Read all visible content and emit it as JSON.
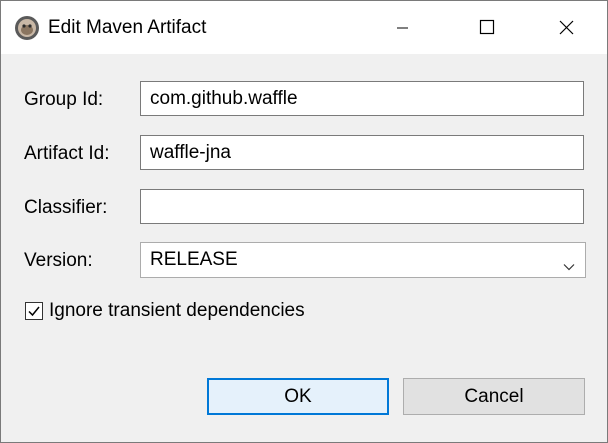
{
  "window": {
    "title": "Edit Maven Artifact"
  },
  "form": {
    "group_id": {
      "label": "Group Id:",
      "value": "com.github.waffle"
    },
    "artifact_id": {
      "label": "Artifact Id:",
      "value": "waffle-jna"
    },
    "classifier": {
      "label": "Classifier:",
      "value": ""
    },
    "version": {
      "label": "Version:",
      "value": "RELEASE"
    }
  },
  "options": {
    "ignore_transient": {
      "label": "Ignore transient dependencies",
      "checked": true
    }
  },
  "buttons": {
    "ok": "OK",
    "cancel": "Cancel"
  },
  "icons": {
    "app": "maven-app-icon",
    "minimize": "minimize-icon",
    "maximize": "maximize-icon",
    "close": "close-icon",
    "dropdown": "chevron-down-icon",
    "checkmark": "checkmark-icon"
  }
}
